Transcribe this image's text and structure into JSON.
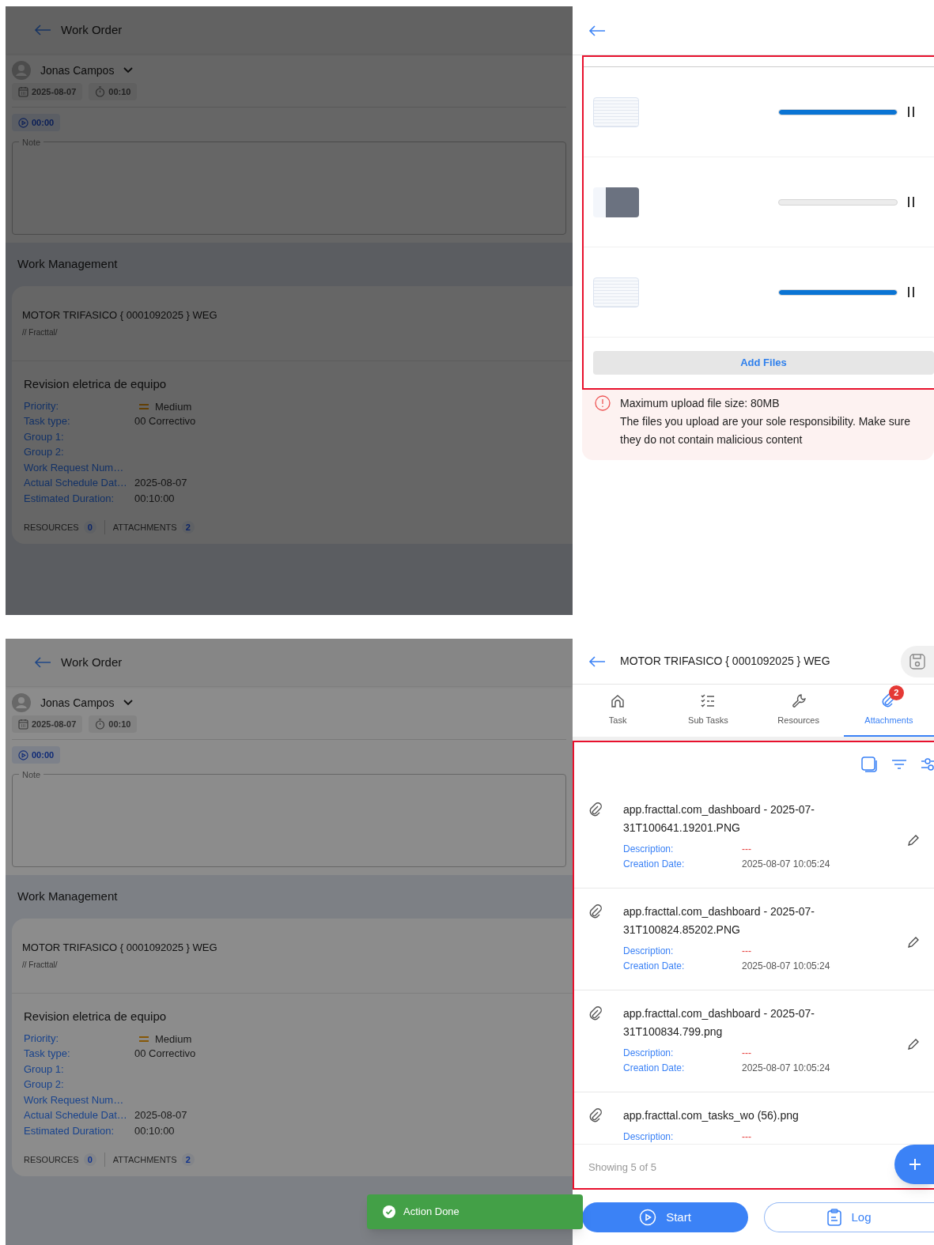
{
  "screens": [
    {
      "work_order": {
        "title": "Work Order",
        "user": "Jonas Campos",
        "date": "2025-08-07",
        "duration": "00:10",
        "timer": "00:00",
        "note_label": "Note",
        "section_title": "Work Management",
        "asset": "MOTOR TRIFASICO { 0001092025 } WEG",
        "asset_path": "// Fracttal/",
        "task_title": "Revision eletrica de equipo",
        "fields": [
          {
            "kind": "priority",
            "label": "Priority:",
            "value": "Medium"
          },
          {
            "kind": "text",
            "label": "Task type:",
            "value": "00 Correctivo"
          },
          {
            "kind": "text",
            "label": "Group 1:"
          },
          {
            "kind": "text",
            "label": "Group 2:"
          },
          {
            "kind": "text",
            "label": "Work Request Num…"
          },
          {
            "kind": "text",
            "label": "Actual Schedule Dat…",
            "value": "2025-08-07"
          },
          {
            "kind": "text",
            "label": "Estimated Duration:",
            "value": "00:10:00"
          }
        ],
        "counters": [
          {
            "label": "RESOURCES",
            "count": "0"
          },
          {
            "label": "ATTACHMENTS",
            "count": "2"
          }
        ]
      },
      "side_panel": {
        "kind": "upload",
        "files": [
          {
            "kind": "light",
            "level": 1
          },
          {
            "kind": "dark",
            "level": 0
          },
          {
            "kind": "light",
            "level": 1
          }
        ],
        "add_button": "Add Files",
        "notice": {
          "title": "Maximum upload file size: 80MB",
          "text": "The files you upload are your sole responsibility. Make sure they do not contain malicious content"
        }
      }
    },
    {
      "work_order": {
        "title": "Work Order",
        "user": "Jonas Campos",
        "date": "2025-08-07",
        "duration": "00:10",
        "timer": "00:00",
        "note_label": "Note",
        "section_title": "Work Management",
        "asset": "MOTOR TRIFASICO { 0001092025 } WEG",
        "asset_path": "// Fracttal/",
        "task_title": "Revision eletrica de equipo",
        "fields": [
          {
            "kind": "priority",
            "label": "Priority:",
            "value": "Medium"
          },
          {
            "kind": "text",
            "label": "Task type:",
            "value": "00 Correctivo"
          },
          {
            "kind": "text",
            "label": "Group 1:"
          },
          {
            "kind": "text",
            "label": "Group 2:"
          },
          {
            "kind": "text",
            "label": "Work Request Num…"
          },
          {
            "kind": "text",
            "label": "Actual Schedule Dat…",
            "value": "2025-08-07"
          },
          {
            "kind": "text",
            "label": "Estimated Duration:",
            "value": "00:10:00"
          }
        ],
        "counters": [
          {
            "label": "RESOURCES",
            "count": "0"
          },
          {
            "label": "ATTACHMENTS",
            "count": "2"
          }
        ]
      },
      "side_panel": {
        "kind": "attachments",
        "title": "MOTOR TRIFASICO { 0001092025 } WEG",
        "tabs": [
          {
            "label": "Task",
            "selected": false
          },
          {
            "label": "Sub Tasks",
            "selected": false
          },
          {
            "label": "Resources",
            "selected": false
          },
          {
            "label": "Attachments",
            "selected": true,
            "badge": "2"
          }
        ],
        "attachments": [
          {
            "name": "app.fracttal.com_dashboard - 2025-07-31T100641.19201.PNG",
            "description_label": "Description:",
            "description": "---",
            "date_label": "Creation Date:",
            "date": "2025-08-07 10:05:24"
          },
          {
            "name": "app.fracttal.com_dashboard - 2025-07-31T100824.85202.PNG",
            "description_label": "Description:",
            "description": "---",
            "date_label": "Creation Date:",
            "date": "2025-08-07 10:05:24"
          },
          {
            "name": "app.fracttal.com_dashboard - 2025-07-31T100834.799.png",
            "description_label": "Description:",
            "description": "---",
            "date_label": "Creation Date:",
            "date": "2025-08-07 10:05:24"
          },
          {
            "name": "app.fracttal.com_tasks_wo (56).png",
            "description_label": "Description:",
            "description": "---"
          }
        ],
        "footer": "Showing 5 of 5",
        "start_button": "Start",
        "log_button": "Log"
      },
      "toast": {
        "text": "Action Done"
      }
    }
  ]
}
